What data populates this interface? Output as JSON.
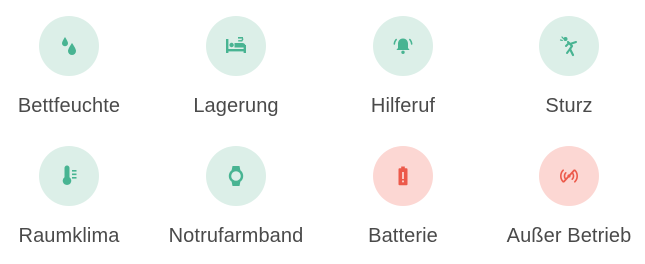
{
  "colors": {
    "green_bg": "#dcefe8",
    "green_icon": "#48b492",
    "red_bg": "#fcd7d3",
    "red_icon": "#ec5a4b",
    "label": "#4a4a4a"
  },
  "tiles": [
    {
      "label": "Bettfeuchte",
      "icon": "water-drops-icon",
      "tone": "green"
    },
    {
      "label": "Lagerung",
      "icon": "bed-icon",
      "tone": "green"
    },
    {
      "label": "Hilferuf",
      "icon": "bell-ringing-icon",
      "tone": "green"
    },
    {
      "label": "Sturz",
      "icon": "falling-person-icon",
      "tone": "green"
    },
    {
      "label": "Raumklima",
      "icon": "thermometer-icon",
      "tone": "green"
    },
    {
      "label": "Notrufarmband",
      "icon": "smartwatch-icon",
      "tone": "green"
    },
    {
      "label": "Batterie",
      "icon": "battery-alert-icon",
      "tone": "red"
    },
    {
      "label": "Außer Betrieb",
      "icon": "signal-off-icon",
      "tone": "red"
    }
  ]
}
